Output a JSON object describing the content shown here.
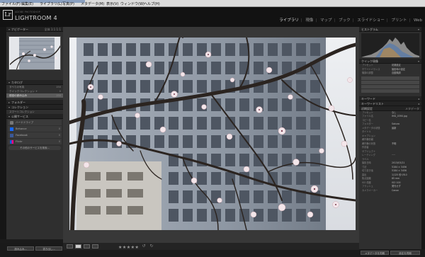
{
  "window": {
    "title": "Lightroom Catalog - Adobe Photoshop Lightroom"
  },
  "menu": [
    "ファイル(F)",
    "編集(E)",
    "ライブラリ(L)",
    "写真(P)",
    "メタデータ(M)",
    "表示(V)",
    "ウィンドウ(W)",
    "ヘルプ(H)"
  ],
  "app": {
    "logo": "Lr",
    "subtitle": "ADOBE PHOTOSHOP",
    "name": "LIGHTROOM 4"
  },
  "modules": [
    "ライブラリ",
    "現像",
    "マップ",
    "ブック",
    "スライドショー",
    "プリント",
    "Web"
  ],
  "left": {
    "navigator": {
      "label": "ナビゲーター",
      "zoom": "全体  1:1  1:1"
    },
    "catalog": {
      "label": "カタログ",
      "items": [
        {
          "label": "すべての写真",
          "count": "150"
        },
        {
          "label": "クイックコレクション +",
          "count": "0"
        },
        {
          "label": "前回の読み込み",
          "count": "150"
        }
      ]
    },
    "folders": "フォルダー",
    "collections": {
      "label": "コレクション",
      "item": "スマートコレクション"
    },
    "publish": {
      "label": "公開サービス",
      "items": [
        {
          "label": "ハードドライブ",
          "count": ""
        },
        {
          "label": "Behance",
          "count": "0"
        },
        {
          "label": "Facebook",
          "count": "0"
        },
        {
          "label": "Flickr",
          "count": "0"
        }
      ],
      "more": "その他のサービスを検索..."
    },
    "import_btn": "読み込み...",
    "export_btn": "書き出し..."
  },
  "right": {
    "histogram": "ヒストグラム",
    "quick_develop": "クイック現像",
    "preset_label": "プリセット",
    "preset_value": "初期設定",
    "wb_label": "ホワイトバランス",
    "wb_value": "撮影時の設定",
    "tone_label": "階調の調整",
    "tone_value": "自動階調",
    "keyword": "キーワード",
    "keyword_list": "キーワードリスト",
    "metadata": "メタデータ",
    "default": "初期設定",
    "meta": [
      {
        "k": "プリセット",
        "v": "なし"
      },
      {
        "k": "ファイル名",
        "v": "IMG_0390.jpg"
      },
      {
        "k": "コピー名",
        "v": ""
      },
      {
        "k": "フォルダー",
        "v": "Sakura"
      },
      {
        "k": "メタデータの状態",
        "v": "最新"
      },
      {
        "k": "タイトル",
        "v": ""
      },
      {
        "k": "キャプション",
        "v": ""
      },
      {
        "k": "著作権情報",
        "v": ""
      },
      {
        "k": "著作権の状態",
        "v": "不明"
      },
      {
        "k": "作成者",
        "v": ""
      },
      {
        "k": "サブジェクト",
        "v": ""
      },
      {
        "k": "レーティング",
        "v": "·····"
      },
      {
        "k": "ラベル",
        "v": ""
      },
      {
        "k": "撮影日時",
        "v": "2013/03/21"
      },
      {
        "k": "寸法",
        "v": "5184 × 3456"
      },
      {
        "k": "切り抜き後",
        "v": "5184 × 3456"
      },
      {
        "k": "露出",
        "v": "1/125 秒 f/8.0"
      },
      {
        "k": "焦点距離",
        "v": "85 mm"
      },
      {
        "k": "ISO 感度",
        "v": "ISO 100"
      },
      {
        "k": "フラッシュ",
        "v": "発光せず"
      },
      {
        "k": "カメラメーカー",
        "v": "Canon"
      }
    ]
  },
  "toolbar": {
    "sync_meta": "メタデータを同期",
    "sync_settings": "設定を同期",
    "stars": "★★★★★"
  },
  "colors": {
    "accent": "#e0e0e0",
    "panel": "#2f2f2f",
    "stage": "#383838"
  }
}
